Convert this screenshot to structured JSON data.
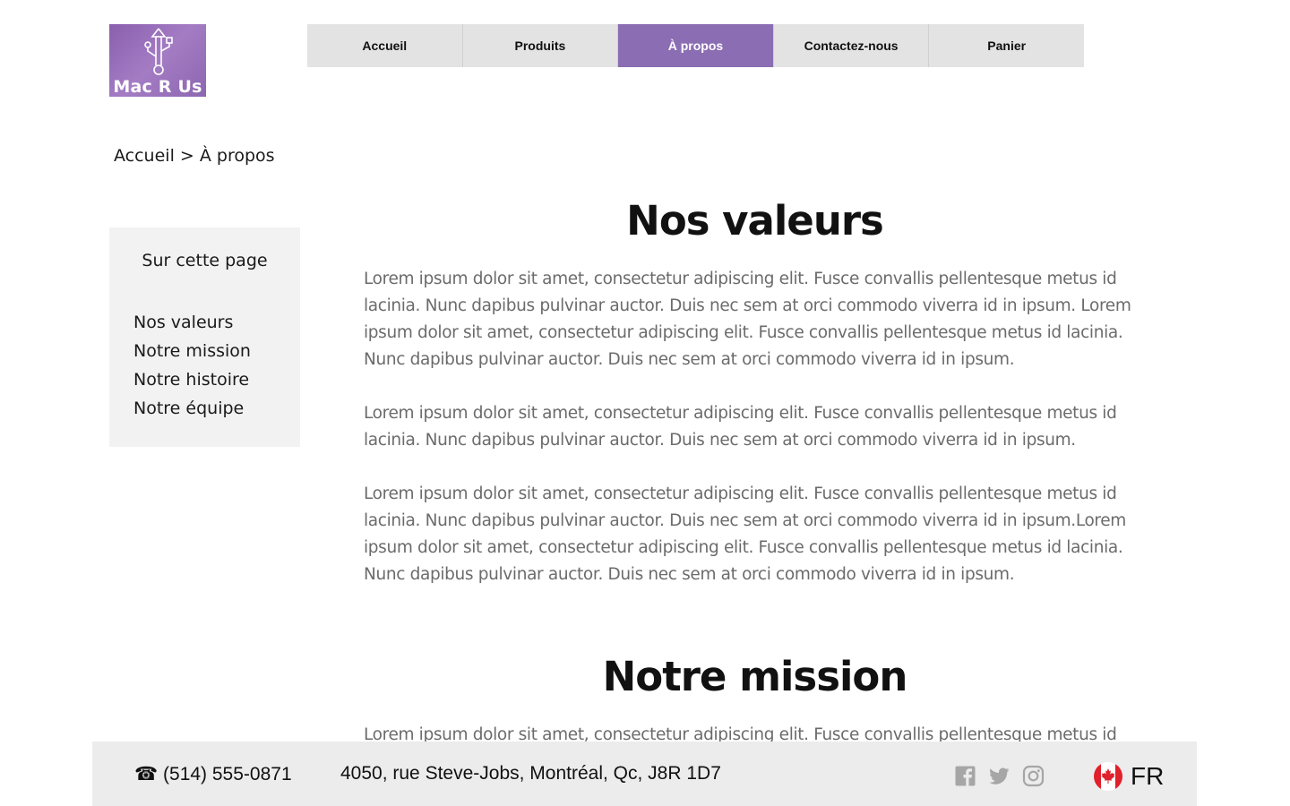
{
  "logo": {
    "text": "Mac R Us"
  },
  "nav": {
    "items": [
      {
        "label": "Accueil"
      },
      {
        "label": "Produits"
      },
      {
        "label": "À propos"
      },
      {
        "label": "Contactez-nous"
      },
      {
        "label": "Panier"
      }
    ],
    "active_index": 2,
    "active_color": "#8b6db3"
  },
  "breadcrumb": {
    "home": "Accueil",
    "separator": ">",
    "current": "À propos"
  },
  "sidebar": {
    "title": "Sur cette page",
    "items": [
      {
        "label": "Nos valeurs"
      },
      {
        "label": "Notre mission"
      },
      {
        "label": "Notre histoire"
      },
      {
        "label": "Notre équipe"
      }
    ]
  },
  "sections": [
    {
      "title": "Nos valeurs",
      "paragraphs": [
        "Lorem ipsum dolor sit amet, consectetur adipiscing elit. Fusce convallis pellentesque metus id lacinia. Nunc dapibus pulvinar auctor. Duis nec sem at orci commodo viverra id in ipsum. Lorem ipsum dolor sit amet, consectetur adipiscing elit. Fusce convallis pellentesque metus id lacinia. Nunc dapibus pulvinar auctor. Duis nec sem at orci commodo viverra id in ipsum.",
        "Lorem ipsum dolor sit amet, consectetur adipiscing elit. Fusce convallis pellentesque metus id lacinia. Nunc dapibus pulvinar auctor. Duis nec sem at orci commodo viverra id in ipsum.",
        "Lorem ipsum dolor sit amet, consectetur adipiscing elit. Fusce convallis pellentesque metus id lacinia. Nunc dapibus pulvinar auctor. Duis nec sem at orci commodo viverra id in ipsum.Lorem ipsum dolor sit amet, consectetur adipiscing elit. Fusce convallis pellentesque metus id lacinia. Nunc dapibus pulvinar auctor. Duis nec sem at orci commodo viverra id in ipsum."
      ]
    },
    {
      "title": "Notre mission",
      "paragraphs": [
        "Lorem ipsum dolor sit amet, consectetur adipiscing elit. Fusce convallis pellentesque metus id"
      ]
    }
  ],
  "footer": {
    "phone_icon": "☎",
    "phone": "(514) 555-0871",
    "address": "4050, rue Steve-Jobs, Montréal, Qc, J8R 1D7",
    "social": [
      "facebook-icon",
      "twitter-icon",
      "instagram-icon"
    ],
    "social_color": "#a6a6a6",
    "language": "FR",
    "flag": "canada-flag-icon"
  }
}
